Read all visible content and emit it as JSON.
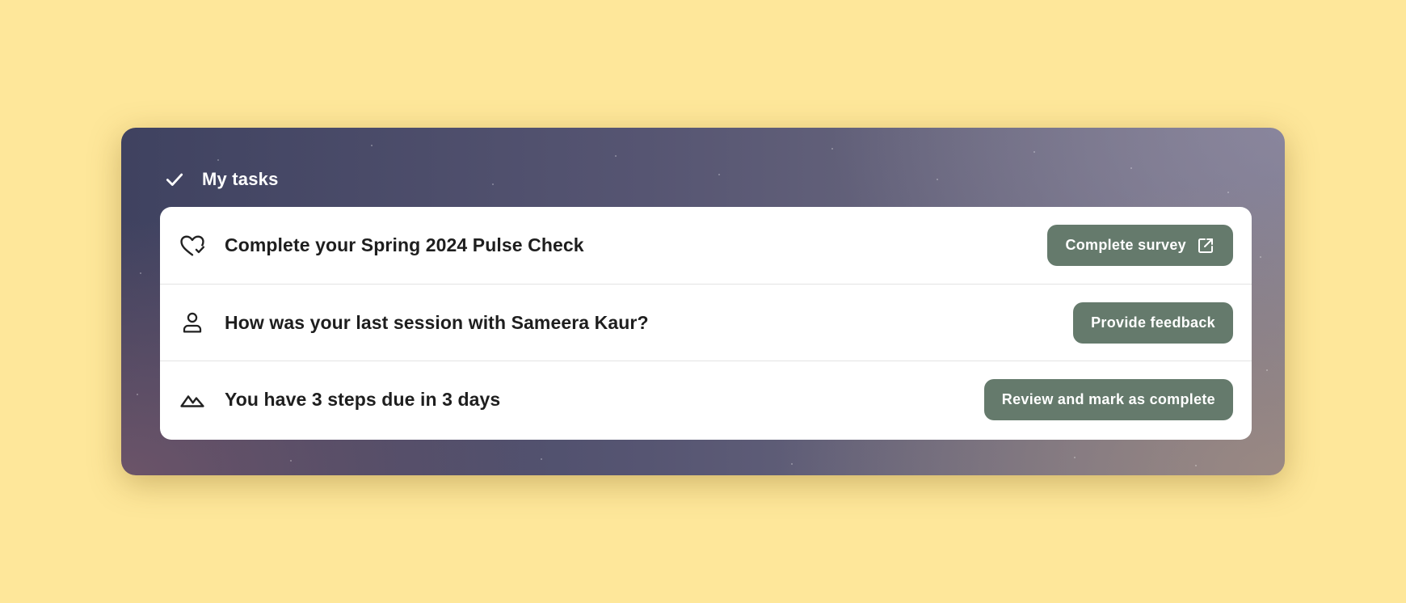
{
  "tasks_card": {
    "title": "My tasks",
    "header_icon": "checkmark-icon",
    "items": [
      {
        "icon": "heart-check-icon",
        "label": "Complete your Spring 2024 Pulse Check",
        "button_label": "Complete survey",
        "button_icon": "external-link-icon"
      },
      {
        "icon": "person-icon",
        "label": "How was your last session with Sameera Kaur?",
        "button_label": "Provide feedback"
      },
      {
        "icon": "mountains-icon",
        "label": "You have 3 steps due in 3 days",
        "button_label": "Review and mark as complete"
      }
    ]
  },
  "colors": {
    "page_background": "#fee79a",
    "button_background": "#657a6c",
    "button_text": "#ffffff",
    "list_background": "#ffffff",
    "item_text": "#1e1e1e"
  }
}
